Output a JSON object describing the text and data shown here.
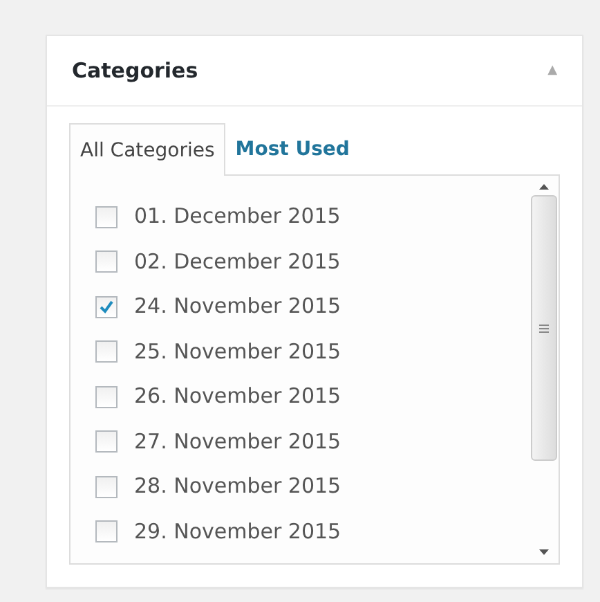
{
  "panel": {
    "title": "Categories",
    "toggle": "▲"
  },
  "tabs": [
    {
      "label": "All Categories",
      "selected": true
    },
    {
      "label": "Most Used",
      "selected": false
    }
  ],
  "categories": [
    {
      "label": "01. December 2015",
      "checked": false
    },
    {
      "label": "02. December 2015",
      "checked": false
    },
    {
      "label": "24. November 2015",
      "checked": true
    },
    {
      "label": "25. November 2015",
      "checked": false
    },
    {
      "label": "26. November 2015",
      "checked": false
    },
    {
      "label": "27. November 2015",
      "checked": false
    },
    {
      "label": "28. November 2015",
      "checked": false
    },
    {
      "label": "29. November 2015",
      "checked": false
    }
  ]
}
